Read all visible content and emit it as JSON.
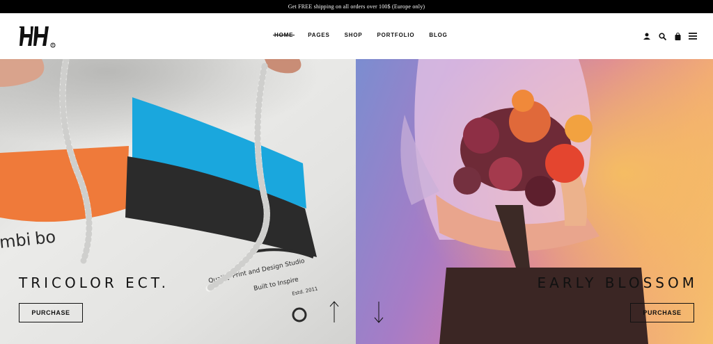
{
  "announcement": "Get FREE shipping on all orders over 100$ (Europe only)",
  "nav": {
    "items": [
      "HOME",
      "PAGES",
      "SHOP",
      "PORTFOLIO",
      "BLOG"
    ],
    "active": "HOME"
  },
  "header_icons": [
    "user-icon",
    "search-icon",
    "shopping-bag-icon",
    "hamburger-menu-icon"
  ],
  "slides": {
    "left": {
      "title": "TRICOLOR ECT.",
      "button": "PURCHASE",
      "print_text": [
        "mbi",
        "bo",
        "Quality Print and Design Studio",
        "Built to Inspire",
        "Estd. 2011"
      ]
    },
    "right": {
      "title": "EARLY BLOSSOM",
      "button": "PURCHASE"
    }
  },
  "colors": {
    "topbar": "#000000",
    "flag_orange": "#ef7a3a",
    "flag_blue": "#1aa7dd",
    "flag_black": "#2b2b2b"
  }
}
